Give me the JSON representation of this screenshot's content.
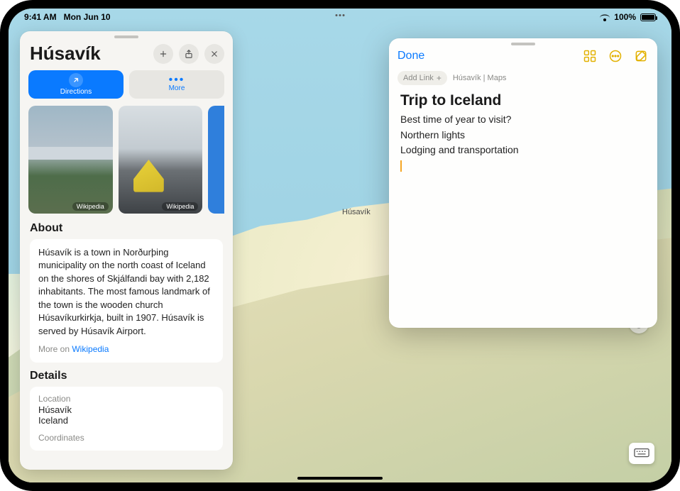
{
  "status": {
    "time": "9:41 AM",
    "date": "Mon Jun 10",
    "battery_pct": "100%"
  },
  "map": {
    "label": "Húsavík"
  },
  "panel": {
    "title": "Húsavík",
    "directions_label": "Directions",
    "more_label": "More",
    "photo_source": "Wikipedia",
    "about_heading": "About",
    "about_text": "Húsavík is a town in Norðurþing municipality on the north coast of Iceland on the shores of Skjálfandi bay with 2,182 inhabitants. The most famous landmark of the town is the wooden church Húsavíkurkirkja, built in 1907. Húsavík is served by Húsavík Airport.",
    "more_on_prefix": "More on ",
    "more_on_link": "Wikipedia",
    "details_heading": "Details",
    "location_label": "Location",
    "location_line1": "Húsavík",
    "location_line2": "Iceland",
    "coords_label": "Coordinates"
  },
  "notes": {
    "done": "Done",
    "add_link": "Add Link",
    "breadcrumb": "Húsavík | Maps",
    "title": "Trip to Iceland",
    "lines": [
      "Best time of year to visit?",
      "Northern lights",
      "Lodging and transportation"
    ]
  }
}
